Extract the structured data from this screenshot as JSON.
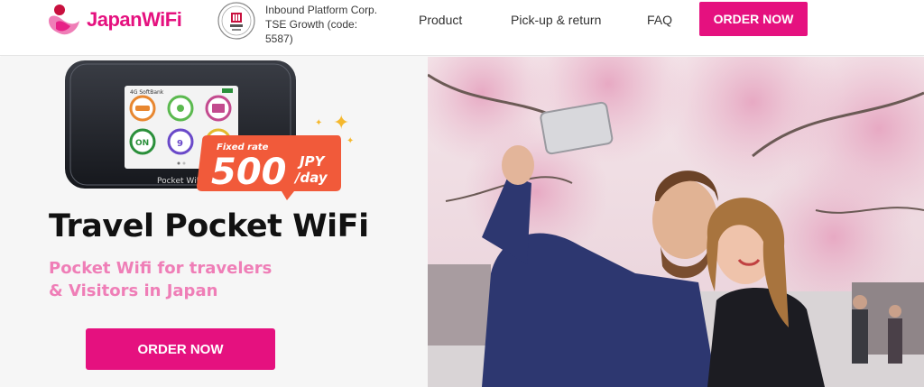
{
  "header": {
    "brand_prefix": "Japan",
    "brand_suffix": "WiFi",
    "corp_line1": "Inbound Platform Corp.",
    "corp_line2": "TSE Growth (code:",
    "corp_line3": "5587)",
    "nav": [
      {
        "label": "Product"
      },
      {
        "label": "Pick-up & return"
      },
      {
        "label": "FAQ"
      }
    ],
    "order_label": "ORDER NOW"
  },
  "hero": {
    "title": "Travel Pocket WiFi",
    "subtitle_line1": "Pocket Wifi for travelers",
    "subtitle_line2": "& Visitors in Japan",
    "order_label": "ORDER NOW",
    "badge": {
      "caption": "Fixed rate",
      "price": "500",
      "currency": "JPY",
      "unit": "/day"
    },
    "device": {
      "carrier": "4G SoftBank",
      "brand": "Pocket WiFi",
      "tile_on": "ON",
      "tile_count": "9"
    }
  },
  "colors": {
    "brand_pink": "#e5117f",
    "subtitle_pink": "#ef7eb7",
    "badge_orange": "#f15a3a",
    "sparkle": "#f5b82e"
  }
}
